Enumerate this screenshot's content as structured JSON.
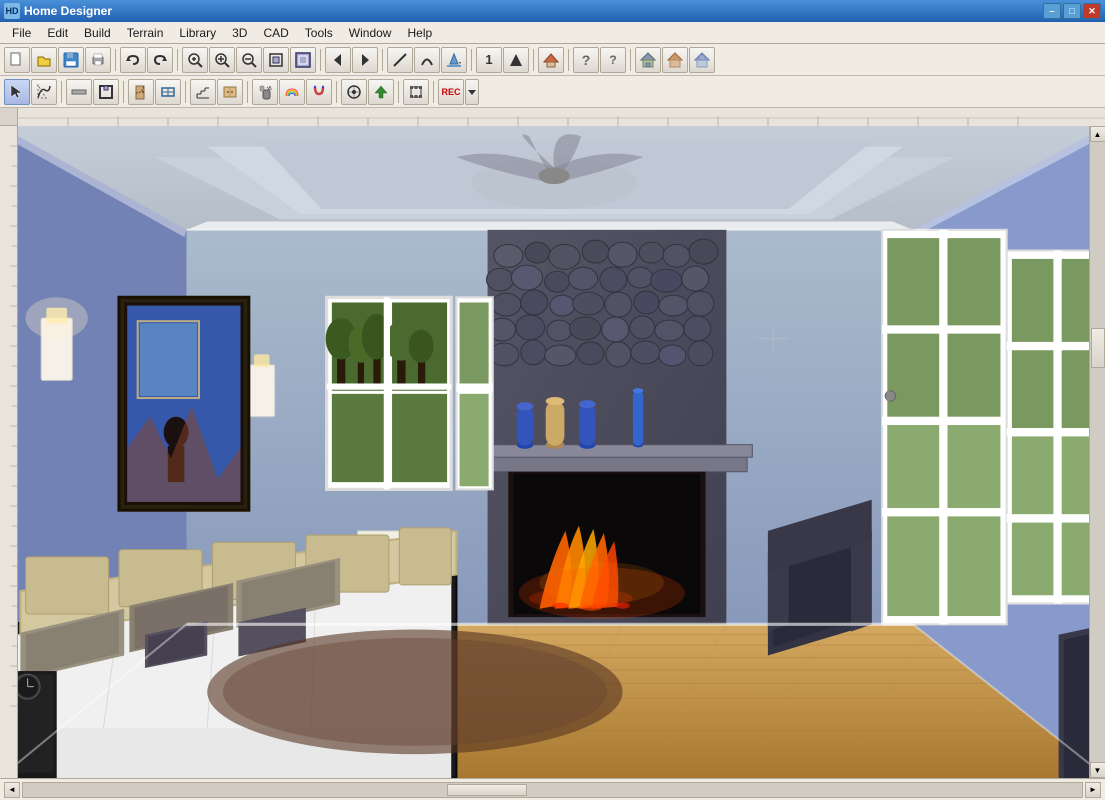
{
  "window": {
    "title": "Home Designer",
    "icon": "HD"
  },
  "titlebar": {
    "minimize": "–",
    "maximize": "□",
    "close": "✕"
  },
  "menu": {
    "items": [
      {
        "id": "file",
        "label": "File"
      },
      {
        "id": "edit",
        "label": "Edit"
      },
      {
        "id": "build",
        "label": "Build"
      },
      {
        "id": "terrain",
        "label": "Terrain"
      },
      {
        "id": "library",
        "label": "Library"
      },
      {
        "id": "3d",
        "label": "3D"
      },
      {
        "id": "cad",
        "label": "CAD"
      },
      {
        "id": "tools",
        "label": "Tools"
      },
      {
        "id": "window",
        "label": "Window"
      },
      {
        "id": "help",
        "label": "Help"
      }
    ]
  },
  "toolbar1": {
    "buttons": [
      {
        "id": "new",
        "icon": "📄",
        "title": "New"
      },
      {
        "id": "open",
        "icon": "📂",
        "title": "Open"
      },
      {
        "id": "save",
        "icon": "💾",
        "title": "Save"
      },
      {
        "id": "print",
        "icon": "🖨",
        "title": "Print"
      },
      {
        "id": "undo",
        "icon": "↩",
        "title": "Undo"
      },
      {
        "id": "redo",
        "icon": "↪",
        "title": "Redo"
      },
      {
        "id": "zoom-in-rect",
        "icon": "🔍",
        "title": "Zoom In"
      },
      {
        "id": "zoom-in",
        "icon": "⊕",
        "title": "Zoom In"
      },
      {
        "id": "zoom-out",
        "icon": "⊖",
        "title": "Zoom Out"
      },
      {
        "id": "fit-page",
        "icon": "⊞",
        "title": "Fit Page"
      },
      {
        "id": "fill-window",
        "icon": "⊡",
        "title": "Fill Window"
      },
      {
        "id": "prev-page",
        "icon": "◄",
        "title": "Previous Page"
      },
      {
        "id": "next-page",
        "icon": "►",
        "title": "Next Page"
      },
      {
        "id": "line",
        "icon": "╱",
        "title": "Line"
      },
      {
        "id": "arc",
        "icon": "⌒",
        "title": "Arc"
      },
      {
        "id": "fill",
        "icon": "▼",
        "title": "Fill"
      },
      {
        "id": "1",
        "icon": "1",
        "title": "One"
      },
      {
        "id": "vert",
        "icon": "↑",
        "title": "Vertical"
      },
      {
        "id": "roof",
        "icon": "⌂",
        "title": "Roof"
      },
      {
        "id": "q1",
        "icon": "?",
        "title": "Help"
      },
      {
        "id": "q2",
        "icon": "?",
        "title": "Help2"
      },
      {
        "id": "sep1",
        "type": "sep"
      },
      {
        "id": "house1",
        "icon": "🏠",
        "title": "House"
      },
      {
        "id": "house2",
        "icon": "🏡",
        "title": "House2"
      },
      {
        "id": "house3",
        "icon": "⌂",
        "title": "House3"
      }
    ]
  },
  "toolbar2": {
    "buttons": [
      {
        "id": "select",
        "icon": "↖",
        "title": "Select"
      },
      {
        "id": "draw",
        "icon": "✏",
        "title": "Draw"
      },
      {
        "id": "wall",
        "icon": "⊣",
        "title": "Wall"
      },
      {
        "id": "room",
        "icon": "▦",
        "title": "Room"
      },
      {
        "id": "door",
        "icon": "🚪",
        "title": "Door"
      },
      {
        "id": "window-tool",
        "icon": "⊞",
        "title": "Window"
      },
      {
        "id": "stair",
        "icon": "≡",
        "title": "Stair"
      },
      {
        "id": "cabinet",
        "icon": "▣",
        "title": "Cabinet"
      },
      {
        "id": "spray",
        "icon": "✦",
        "title": "Spray"
      },
      {
        "id": "rainbow",
        "icon": "🌈",
        "title": "Rainbow"
      },
      {
        "id": "magnet",
        "icon": "⊕",
        "title": "Magnet"
      },
      {
        "id": "place",
        "icon": "◎",
        "title": "Place"
      },
      {
        "id": "move-up",
        "icon": "↑",
        "title": "Move Up"
      },
      {
        "id": "transform",
        "icon": "⌖",
        "title": "Transform"
      },
      {
        "id": "rec",
        "icon": "REC",
        "title": "Record"
      },
      {
        "id": "dropdown",
        "icon": "▼",
        "title": "Dropdown"
      }
    ]
  },
  "statusbar": {
    "text": ""
  },
  "scene": {
    "description": "3D bedroom interior with fireplace",
    "colors": {
      "ceiling": "#b8c0cc",
      "walls": "#8899aa",
      "floor": "#c8a870",
      "fireplace_wall": "#555",
      "sky": "#7a9955"
    }
  }
}
